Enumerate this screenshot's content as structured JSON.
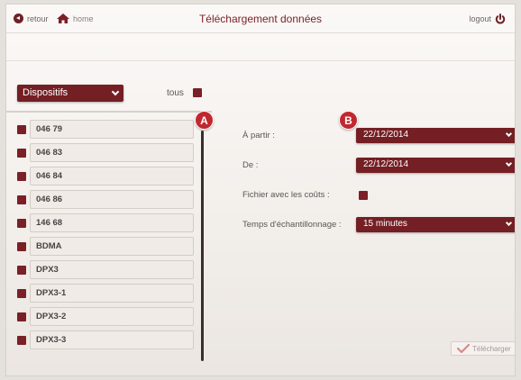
{
  "header": {
    "back_label": "retour",
    "home_label": "home",
    "title": "Téléchargement données",
    "logout_label": "logout"
  },
  "left": {
    "device_select": "Dispositifs",
    "all_label": "tous",
    "items": [
      {
        "label": "046 79"
      },
      {
        "label": "046 83"
      },
      {
        "label": "046 84"
      },
      {
        "label": "046 86"
      },
      {
        "label": "146 68"
      },
      {
        "label": "BDMA"
      },
      {
        "label": "DPX3"
      },
      {
        "label": "DPX3-1"
      },
      {
        "label": "DPX3-2"
      },
      {
        "label": "DPX3-3"
      }
    ]
  },
  "badges": {
    "a": "A",
    "b": "B"
  },
  "form": {
    "from_label": "À partir :",
    "from_value": "22/12/2014",
    "to_label": "De :",
    "to_value": "22/12/2014",
    "costs_label": "Fichier avec les coûts :",
    "sampling_label": "Temps d'échantillonnage :",
    "sampling_value": "15 minutes"
  },
  "actions": {
    "download_label": "Télécharger"
  },
  "colors": {
    "accent": "#741f24",
    "badge": "#c0282f",
    "title": "#7a2228"
  }
}
